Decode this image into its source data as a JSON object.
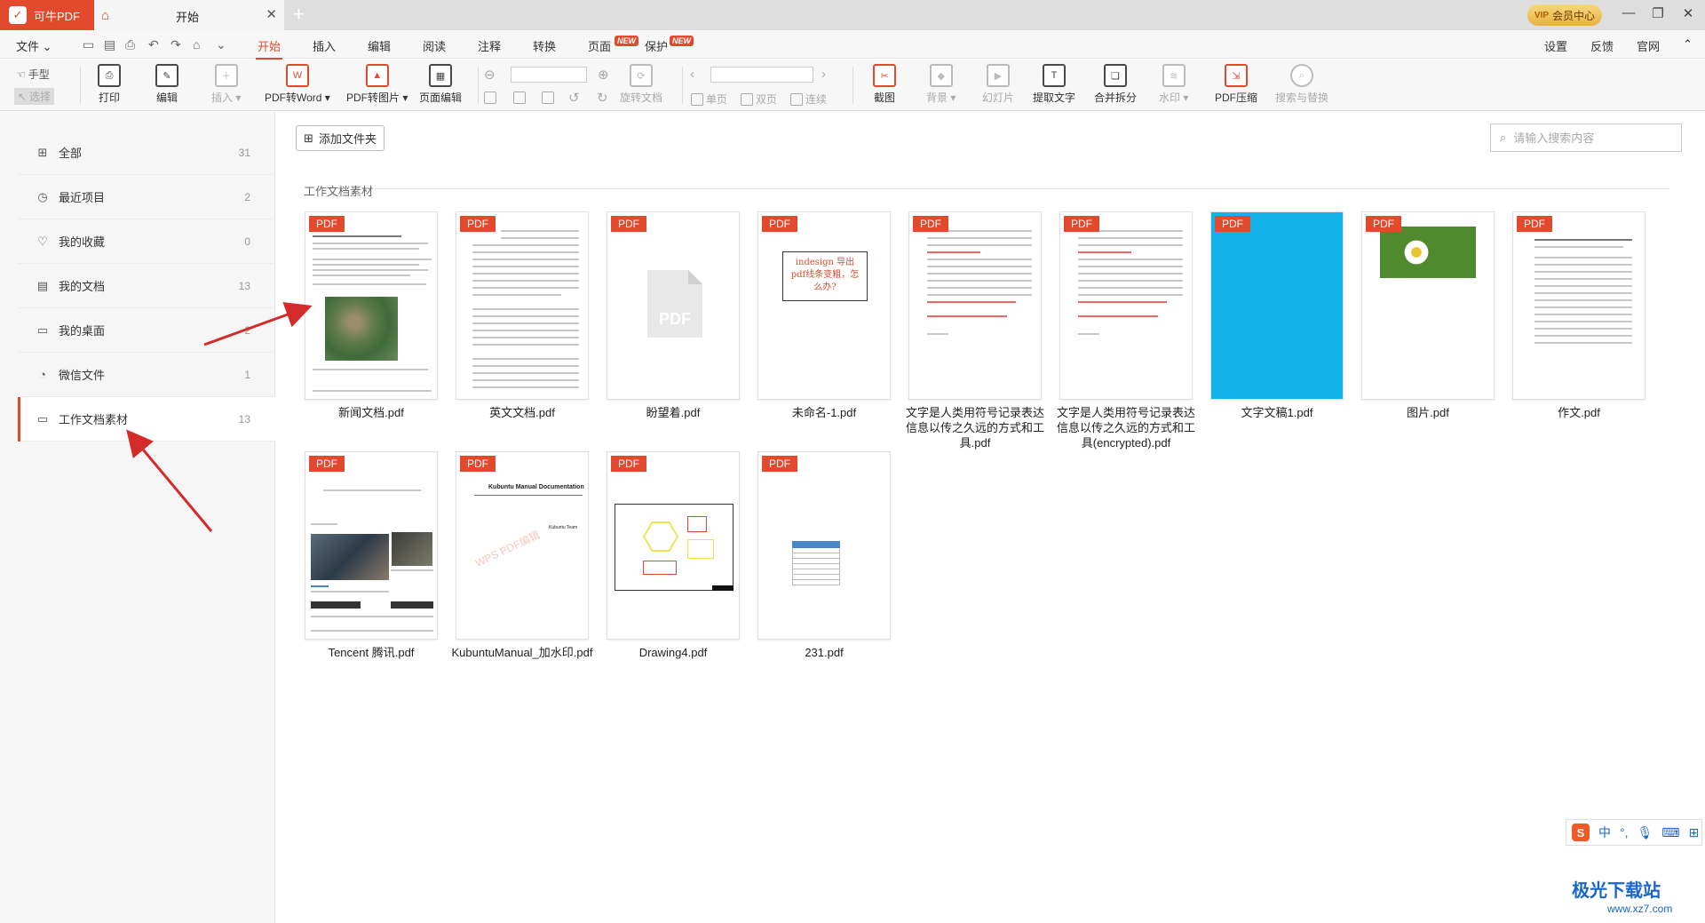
{
  "app": {
    "name": "可牛PDF",
    "logo_char": "✓"
  },
  "tabs": [
    {
      "label": "开始"
    }
  ],
  "title_bar": {
    "vip_label": "会员中心",
    "vip_badge": "VIP"
  },
  "menu": {
    "file": "文件",
    "items": [
      "开始",
      "插入",
      "编辑",
      "阅读",
      "注释",
      "转换",
      "页面",
      "保护"
    ],
    "active": "开始",
    "new_badge": "NEW",
    "right": [
      "设置",
      "反馈",
      "官网"
    ]
  },
  "ribbon": {
    "hand": "手型",
    "select": "选择",
    "print": "打印",
    "edit": "编辑",
    "insert": "插入",
    "pdf_to_word": "PDF转Word",
    "pdf_to_image": "PDF转图片",
    "page_edit": "页面编辑",
    "rotate": "旋转文档",
    "single": "单页",
    "double": "双页",
    "continuous": "连续",
    "screenshot": "截图",
    "background": "背景",
    "slideshow": "幻灯片",
    "extract_text": "提取文字",
    "merge_split": "合并拆分",
    "watermark": "水印",
    "compress": "PDF压缩",
    "search_replace": "搜索与替换"
  },
  "sidebar": {
    "items": [
      {
        "label": "全部",
        "count": "31",
        "icon": "grid-icon"
      },
      {
        "label": "最近项目",
        "count": "2",
        "icon": "clock-icon"
      },
      {
        "label": "我的收藏",
        "count": "0",
        "icon": "heart-icon"
      },
      {
        "label": "我的文档",
        "count": "13",
        "icon": "document-icon"
      },
      {
        "label": "我的桌面",
        "count": "2",
        "icon": "monitor-icon"
      },
      {
        "label": "微信文件",
        "count": "1",
        "icon": "wechat-icon"
      },
      {
        "label": "工作文档素材",
        "count": "13",
        "icon": "folder-icon"
      }
    ],
    "active_index": 6
  },
  "main": {
    "add_folder": "添加文件夹",
    "search_placeholder": "请输入搜索内容",
    "folder_title": "工作文档素材",
    "pdf_tag": "PDF",
    "files": [
      {
        "name": "新闻文档.pdf",
        "thumb": "news"
      },
      {
        "name": "英文文档.pdf",
        "thumb": "english"
      },
      {
        "name": "盼望着.pdf",
        "thumb": "generic"
      },
      {
        "name": "未命名-1.pdf",
        "thumb": "indesign"
      },
      {
        "name": "文字是人类用符号记录表达信息以传之久远的方式和工具.pdf",
        "thumb": "chinese"
      },
      {
        "name": "文字是人类用符号记录表达信息以传之久远的方式和工具(encrypted).pdf",
        "thumb": "chinese"
      },
      {
        "name": "文字文稿1.pdf",
        "thumb": "blue"
      },
      {
        "name": "图片.pdf",
        "thumb": "daisy"
      },
      {
        "name": "作文.pdf",
        "thumb": "essay"
      },
      {
        "name": "Tencent 腾讯.pdf",
        "thumb": "tencent"
      },
      {
        "name": "KubuntuManual_加水印.pdf",
        "thumb": "kubuntu"
      },
      {
        "name": "Drawing4.pdf",
        "thumb": "drawing"
      },
      {
        "name": "231.pdf",
        "thumb": "table"
      }
    ]
  },
  "thumb_text": {
    "indesign": "indesign 导出pdf线条变粗，怎么办?",
    "kubuntu_title": "Kubuntu Manual Documentation",
    "kubuntu_sub": "Kubuntu Team",
    "kubuntu_watermark": "WPS PDF编辑",
    "generic_label": "PDF"
  },
  "ime": {
    "s": "S",
    "lang": "中"
  },
  "watermark_site": {
    "logo": "极光下载站",
    "url": "www.xz7.com"
  }
}
